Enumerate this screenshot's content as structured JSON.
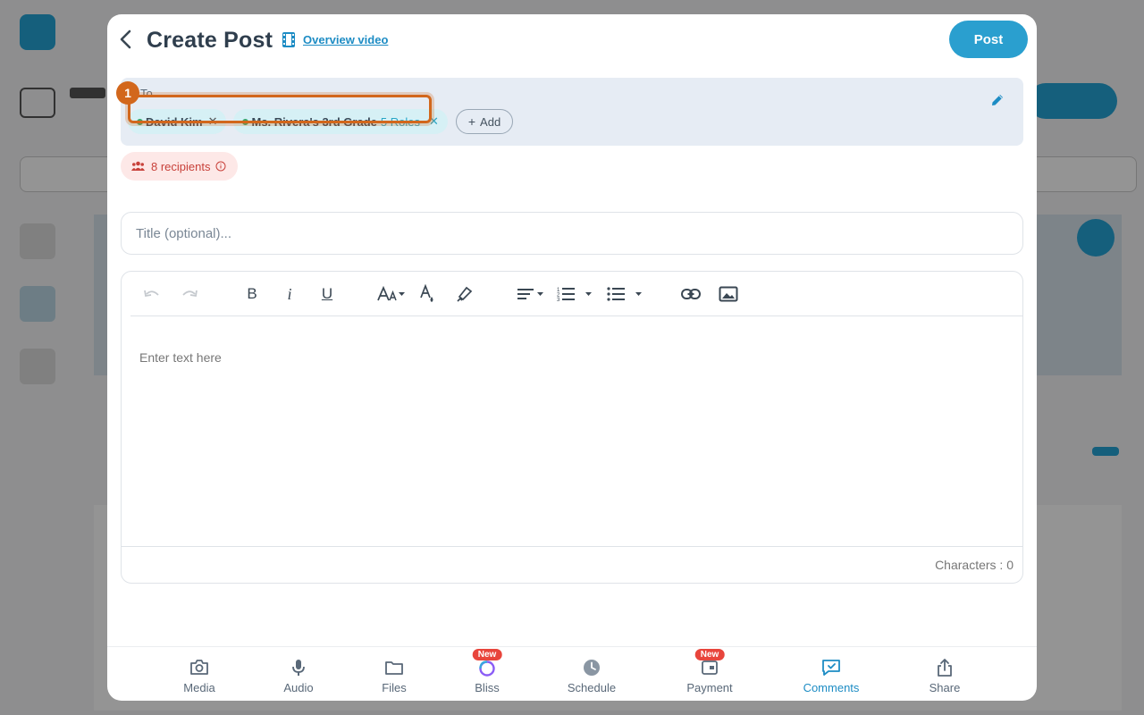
{
  "header": {
    "title": "Create Post",
    "overview_video_label": "Overview video",
    "post_label": "Post"
  },
  "to": {
    "label": "To",
    "chips": [
      {
        "name": "David Kim",
        "extra": ""
      },
      {
        "name": "Ms. Rivera's 3rd Grade",
        "extra": "5 Roles"
      }
    ],
    "add_label": "Add",
    "recipients_label": "8 recipients"
  },
  "annotation": {
    "step": "1",
    "color": "#d2671c"
  },
  "title_field": {
    "placeholder": "Title (optional)..."
  },
  "editor": {
    "placeholder": "Enter text here",
    "char_count_label": "Characters : 0",
    "toolbar": [
      "undo-icon",
      "redo-icon",
      "bold-icon",
      "italic-icon",
      "underline-icon",
      "font-size-icon",
      "text-color-icon",
      "highlighter-icon",
      "align-icon",
      "numbered-list-icon",
      "bullet-list-icon",
      "link-icon",
      "image-icon"
    ]
  },
  "bottom_nav": {
    "items": [
      {
        "label": "Media",
        "icon": "camera-icon"
      },
      {
        "label": "Audio",
        "icon": "microphone-icon"
      },
      {
        "label": "Files",
        "icon": "folder-icon"
      },
      {
        "label": "Bliss",
        "icon": "bliss-icon",
        "badge": "New"
      },
      {
        "label": "Schedule",
        "icon": "clock-icon"
      },
      {
        "label": "Payment",
        "icon": "payment-icon",
        "badge": "New"
      },
      {
        "label": "Comments",
        "icon": "comments-icon",
        "active": true
      },
      {
        "label": "Share",
        "icon": "share-icon"
      }
    ]
  },
  "colors": {
    "accent": "#2a9fcf",
    "link": "#1d8cc4",
    "recipients_bg": "#fde8e7",
    "recipients_text": "#c8413a",
    "badge": "#e8453c"
  }
}
